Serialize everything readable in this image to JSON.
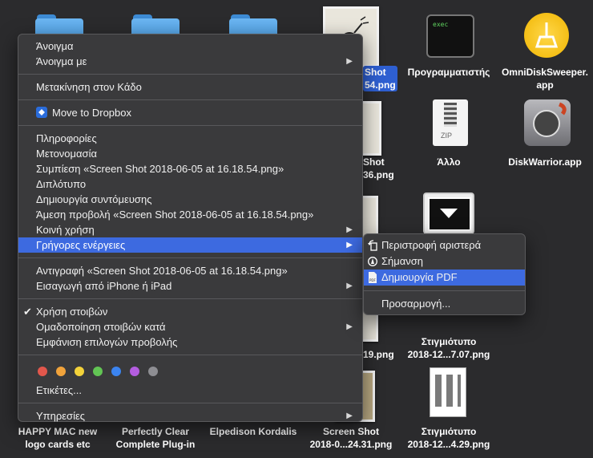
{
  "desktop": {
    "icons": {
      "screenshot_selected": "Shot\n54.png",
      "programmer": "Προγραμματιστής",
      "omnidisk": "OmniDiskSweeper.\napp",
      "shot_36": "Shot\n36.png",
      "allo": "Άλλο",
      "diskwarrior": "DiskWarrior.app",
      "shot_19": "19.png",
      "stigmiotypo_707": "Στιγμιότυπο\n2018-12...7.07.png",
      "happymac": "HAPPY MAC new\nlogo cards etc",
      "perfectly": "Perfectly Clear\nComplete Plug-in",
      "elpedison": "Elpedison Kordalis",
      "screenshot_2431": "Screen Shot\n2018-0...24.31.png",
      "stigmiotypo_429": "Στιγμιότυπο\n2018-12...4.29.png"
    }
  },
  "context_menu": {
    "open": "Άνοιγμα",
    "open_with": "Άνοιγμα με",
    "move_to_trash": "Μετακίνηση στον Κάδο",
    "move_to_dropbox": "Move to Dropbox",
    "get_info": "Πληροφορίες",
    "rename": "Μετονομασία",
    "compress": "Συμπίεση «Screen Shot 2018-06-05 at 16.18.54.png»",
    "duplicate": "Διπλότυπο",
    "make_alias": "Δημιουργία συντόμευσης",
    "quick_look": "Άμεση προβολή «Screen Shot 2018-06-05 at 16.18.54.png»",
    "share": "Κοινή χρήση",
    "quick_actions": "Γρήγορες ενέργειες",
    "copy": "Αντιγραφή «Screen Shot 2018-06-05 at 16.18.54.png»",
    "import_iphone": "Εισαγωγή από iPhone ή iPad",
    "use_stacks": "Χρήση στοιβών",
    "group_stacks": "Ομαδοποίηση στοιβών κατά",
    "show_view_options": "Εμφάνιση επιλογών προβολής",
    "tags": "Ετικέτες...",
    "services": "Υπηρεσίες",
    "tag_colors": [
      "#e2574c",
      "#f1a33b",
      "#f3d23a",
      "#62c554",
      "#3b84f0",
      "#b45de0",
      "#8e8e93"
    ]
  },
  "submenu": {
    "rotate_left": "Περιστροφή αριστερά",
    "markup": "Σήμανση",
    "create_pdf": "Δημιουργία PDF",
    "customize": "Προσαρμογή..."
  },
  "colors": {
    "highlight": "#3d6ae0",
    "menu_bg": "#3a3a3c"
  }
}
